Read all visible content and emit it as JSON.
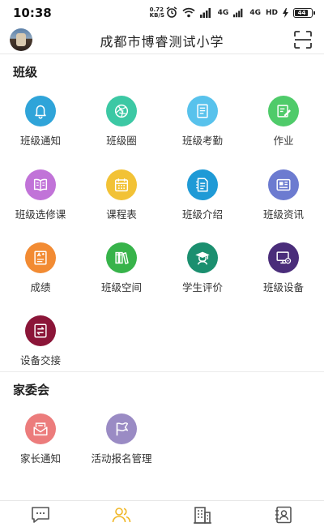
{
  "status_bar": {
    "time": "10:38",
    "speed_value": "0.72",
    "speed_unit": "KB/S",
    "signal1_label": "4G",
    "signal2_label": "4G",
    "hd_label": "HD",
    "battery_level": "44"
  },
  "header": {
    "title": "成都市博睿测试小学"
  },
  "sections": {
    "class": {
      "title": "班级",
      "items": [
        {
          "label": "班级通知",
          "icon": "bell-icon",
          "color": "#2fa4d9"
        },
        {
          "label": "班级圈",
          "icon": "aperture-icon",
          "color": "#3cc8a4"
        },
        {
          "label": "班级考勤",
          "icon": "document-icon",
          "color": "#58c2ec"
        },
        {
          "label": "作业",
          "icon": "edit-icon",
          "color": "#4fcb6a"
        },
        {
          "label": "班级选修课",
          "icon": "book-icon",
          "color": "#c173d8"
        },
        {
          "label": "课程表",
          "icon": "calendar-icon",
          "color": "#f2c236"
        },
        {
          "label": "班级介绍",
          "icon": "file-icon",
          "color": "#1f9ad6"
        },
        {
          "label": "班级资讯",
          "icon": "news-icon",
          "color": "#6c7bd0"
        },
        {
          "label": "成绩",
          "icon": "score-icon",
          "color": "#f28b33"
        },
        {
          "label": "班级空间",
          "icon": "books-icon",
          "color": "#37b34a"
        },
        {
          "label": "学生评价",
          "icon": "graduate-icon",
          "color": "#1b8f6f"
        },
        {
          "label": "班级设备",
          "icon": "monitor-settings-icon",
          "color": "#4a2d7a"
        },
        {
          "label": "设备交接",
          "icon": "exchange-icon",
          "color": "#8b1538"
        }
      ]
    },
    "committee": {
      "title": "家委会",
      "items": [
        {
          "label": "家长通知",
          "icon": "envelope-icon",
          "color": "#ec7c7c"
        },
        {
          "label": "活动报名管理",
          "icon": "flag-icon",
          "color": "#9a8bc4"
        }
      ]
    }
  },
  "bottom_nav": {
    "items": [
      {
        "icon": "message-icon",
        "active": false
      },
      {
        "icon": "people-icon",
        "active": true
      },
      {
        "icon": "building-icon",
        "active": false
      },
      {
        "icon": "contact-icon",
        "active": false
      }
    ],
    "active_color": "#f0b728",
    "inactive_color": "#555555"
  }
}
